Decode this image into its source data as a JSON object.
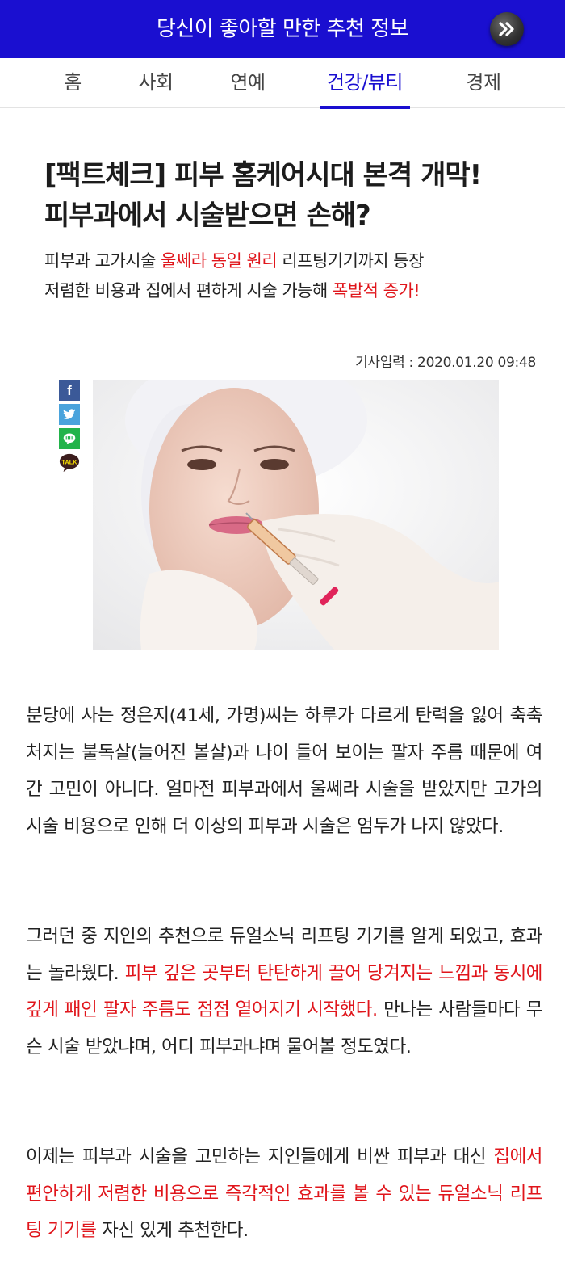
{
  "header": {
    "title": "당신이 좋아할 만한 추천 정보",
    "next_icon": "double-chevron-right-icon",
    "bar_color": "#1a0fd0"
  },
  "nav": {
    "items": [
      {
        "label": "홈"
      },
      {
        "label": "사회"
      },
      {
        "label": "연예"
      },
      {
        "label": "건강/뷰티"
      },
      {
        "label": "경제"
      }
    ],
    "active": "건강/뷰티"
  },
  "article": {
    "headline_line1": "[팩트체크] 피부 홈케어시대 본격 개막!",
    "headline_line2": "피부과에서 시술받으면 손해?",
    "sub1_a": "피부과 고가시술 ",
    "sub1_b": "울쎄라 동일 원리",
    "sub1_c": " 리프팅기기까지 등장",
    "sub2_a": "저렴한 비용과 집에서 편하게 시술 가능해 ",
    "sub2_b": "폭발적 증가!",
    "date": "기사입력 : 2020.01.20  09:48",
    "share": {
      "facebook": "f",
      "talk": "TALK"
    },
    "p1": "분당에 사는 정은지(41세, 가명)씨는 하루가 다르게 탄력을 잃어 축축처지는 불독살(늘어진 볼살)과 나이 들어 보이는 팔자 주름 때문에 여간 고민이 아니다. 얼마전 피부과에서 울쎄라 시술을 받았지만 고가의 시술 비용으로 인해 더 이상의 피부과 시술은 엄두가 나지 않았다.",
    "p2_a": "그러던 중 지인의 추천으로 듀얼소닉 리프팅 기기를 알게 되었고, 효과는 놀라웠다. ",
    "p2_b": "피부 깊은 곳부터 탄탄하게 끌어 당겨지는 느낌과 동시에 깊게 패인 팔자 주름도 점점 옅어지기 시작했다.",
    "p2_c": " 만나는 사람들마다 무슨 시술 받았냐며, 어디 피부과냐며 물어볼 정도였다.",
    "p3_a": "이제는 피부과 시술을 고민하는 지인들에게 비싼 피부과 대신 ",
    "p3_b": "집에서 편안하게 저렴한 비용으로 즉각적인 효과를 볼 수 있는 듀얼소닉 리프팅 기기를",
    "p3_c": " 자신 있게 추천한다."
  },
  "colors": {
    "accent": "#1a0fd0",
    "highlight_red": "#e0151b"
  }
}
